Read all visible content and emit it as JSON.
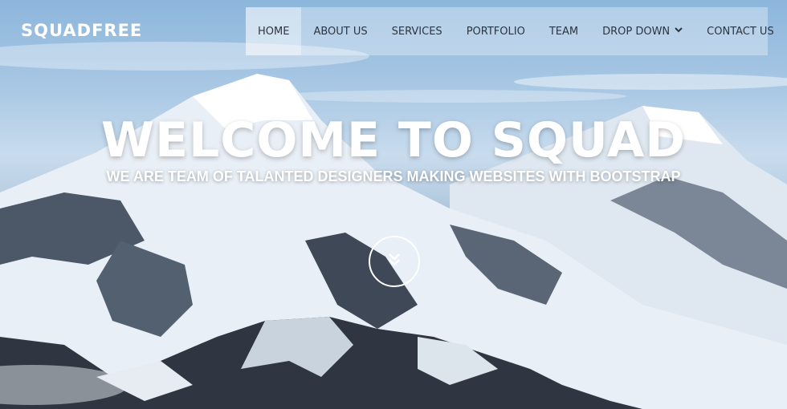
{
  "brand": {
    "logo_text": "SQUADFREE"
  },
  "nav": {
    "items": [
      {
        "label": "HOME",
        "active": true
      },
      {
        "label": "ABOUT US"
      },
      {
        "label": "SERVICES"
      },
      {
        "label": "PORTFOLIO"
      },
      {
        "label": "TEAM"
      },
      {
        "label": "DROP DOWN",
        "has_dropdown": true
      },
      {
        "label": "CONTACT US"
      }
    ]
  },
  "hero": {
    "title": "WELCOME TO SQUAD",
    "subtitle": "WE ARE TEAM OF TALANTED DESIGNERS MAKING WEBSITES WITH BOOTSTRAP",
    "scroll_icon": "chevrons-down-icon"
  },
  "colors": {
    "text_light": "#ffffff",
    "nav_text": "#2c3540",
    "sky": "#8db6dc",
    "snow": "#eef3f8",
    "rock": "#3a4350"
  }
}
